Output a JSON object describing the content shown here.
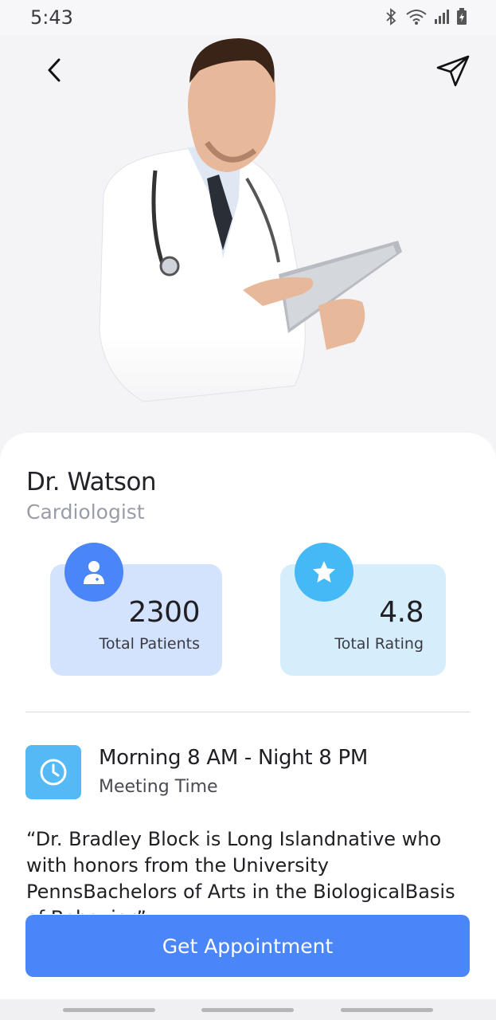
{
  "status_bar": {
    "time": "5:43"
  },
  "doctor": {
    "name": "Dr. Watson",
    "specialty": "Cardiologist"
  },
  "stats": {
    "patients": {
      "value": "2300",
      "label": "Total Patients"
    },
    "rating": {
      "value": "4.8",
      "label": "Total Rating"
    }
  },
  "meeting": {
    "time": "Morning 8 AM - Night 8 PM",
    "label": "Meeting Time"
  },
  "bio": "“Dr. Bradley Block is Long Islandnative who with honors from the University PennsBachelors of   Arts in the BiologicalBasis of Behavior”",
  "cta": {
    "label": "Get Appointment"
  },
  "colors": {
    "primary": "#4a86f7",
    "secondary": "#45b9f5"
  }
}
